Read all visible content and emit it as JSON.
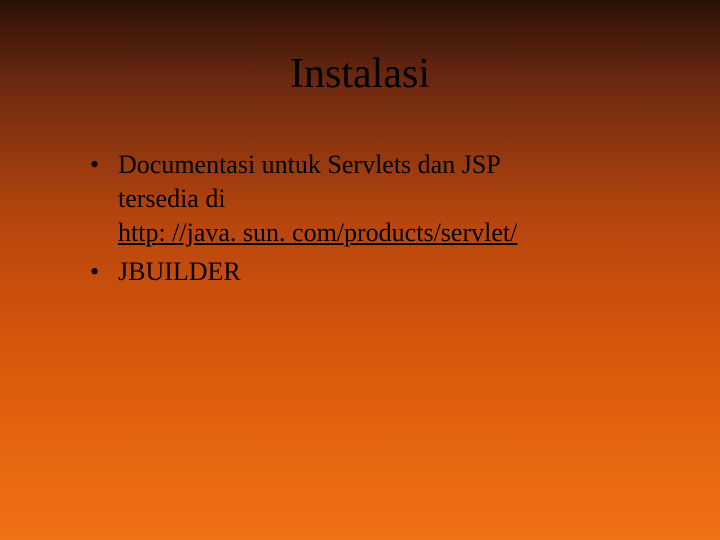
{
  "slide": {
    "title": "Instalasi",
    "bullets": [
      {
        "line1": "Documentasi untuk Servlets dan JSP",
        "line2": "tersedia di",
        "link": "http: //java. sun. com/products/servlet/"
      },
      {
        "text": "JBUILDER"
      }
    ]
  }
}
